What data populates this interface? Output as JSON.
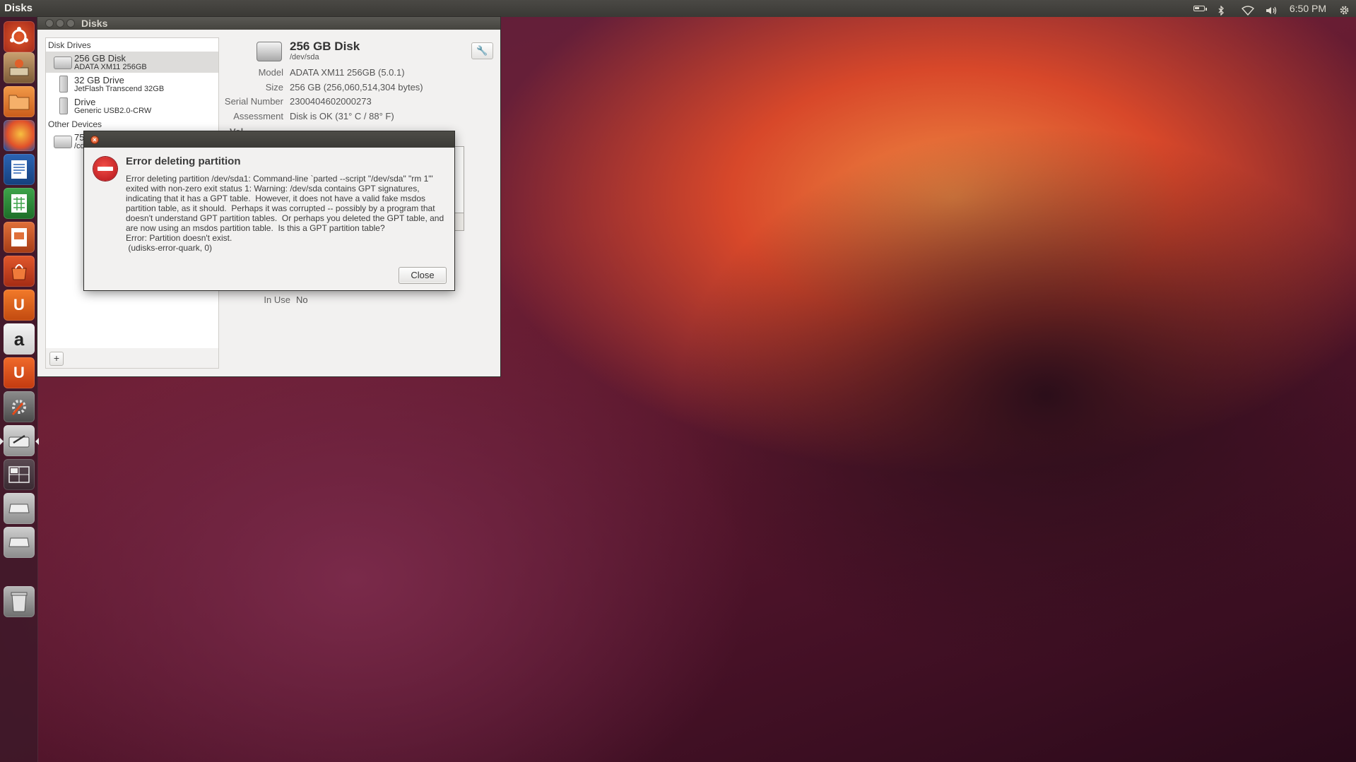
{
  "top_panel": {
    "app_name": "Disks",
    "clock": "6:50 PM",
    "indicators": [
      "battery-icon",
      "bluetooth-icon",
      "wifi-icon",
      "volume-icon",
      "gear-icon"
    ]
  },
  "launcher": {
    "items": [
      "ubuntu-dash-icon",
      "system-installer-icon",
      "files-icon",
      "firefox-icon",
      "libreoffice-writer-icon",
      "libreoffice-calc-icon",
      "libreoffice-impress-icon",
      "software-center-icon",
      "ubuntu-one-icon",
      "amazon-icon",
      "ubuntu-one-music-icon",
      "system-settings-icon",
      "disks-icon",
      "workspace-switcher-icon",
      "drive-icon",
      "drive-icon",
      "trash-icon"
    ],
    "amazon_glyph": "a",
    "ubuntu_one_glyph": "U",
    "music_glyph": "U"
  },
  "disks_window": {
    "title": "Disks",
    "sidebar": {
      "disk_drives_header": "Disk Drives",
      "drives": [
        {
          "name": "256 GB Disk",
          "sub": "ADATA XM11 256GB"
        },
        {
          "name": "32 GB Drive",
          "sub": "JetFlash Transcend 32GB"
        },
        {
          "name": "Drive",
          "sub": "Generic USB2.0-CRW"
        }
      ],
      "other_devices_header": "Other Devices",
      "other": {
        "name": "75",
        "sub": "/cd"
      },
      "add_label": "+"
    },
    "detail": {
      "title": "256 GB Disk",
      "devpath": "/dev/sda",
      "props": [
        {
          "label": "Model",
          "value": "ADATA XM11 256GB (5.0.1)"
        },
        {
          "label": "Size",
          "value": "256 GB (256,060,514,304 bytes)"
        },
        {
          "label": "Serial Number",
          "value": "2300404602000273"
        },
        {
          "label": "Assessment",
          "value": "Disk is OK (31° C / 88° F)"
        }
      ],
      "volumes_fragment": "Vol",
      "in_use_label": "In Use",
      "in_use_value": "No",
      "wrench_glyph": "🔧"
    }
  },
  "error_dialog": {
    "title": "Error deleting partition",
    "body": "Error deleting partition /dev/sda1: Command-line `parted --script \"/dev/sda\" \"rm 1\"' exited with non-zero exit status 1: Warning: /dev/sda contains GPT signatures, indicating that it has a GPT table.  However, it does not have a valid fake msdos partition table, as it should.  Perhaps it was corrupted -- possibly by a program that doesn't understand GPT partition tables.  Or perhaps you deleted the GPT table, and are now using an msdos partition table.  Is this a GPT partition table?\nError: Partition doesn't exist.\n (udisks-error-quark, 0)",
    "close_label": "Close",
    "close_glyph": "×"
  }
}
